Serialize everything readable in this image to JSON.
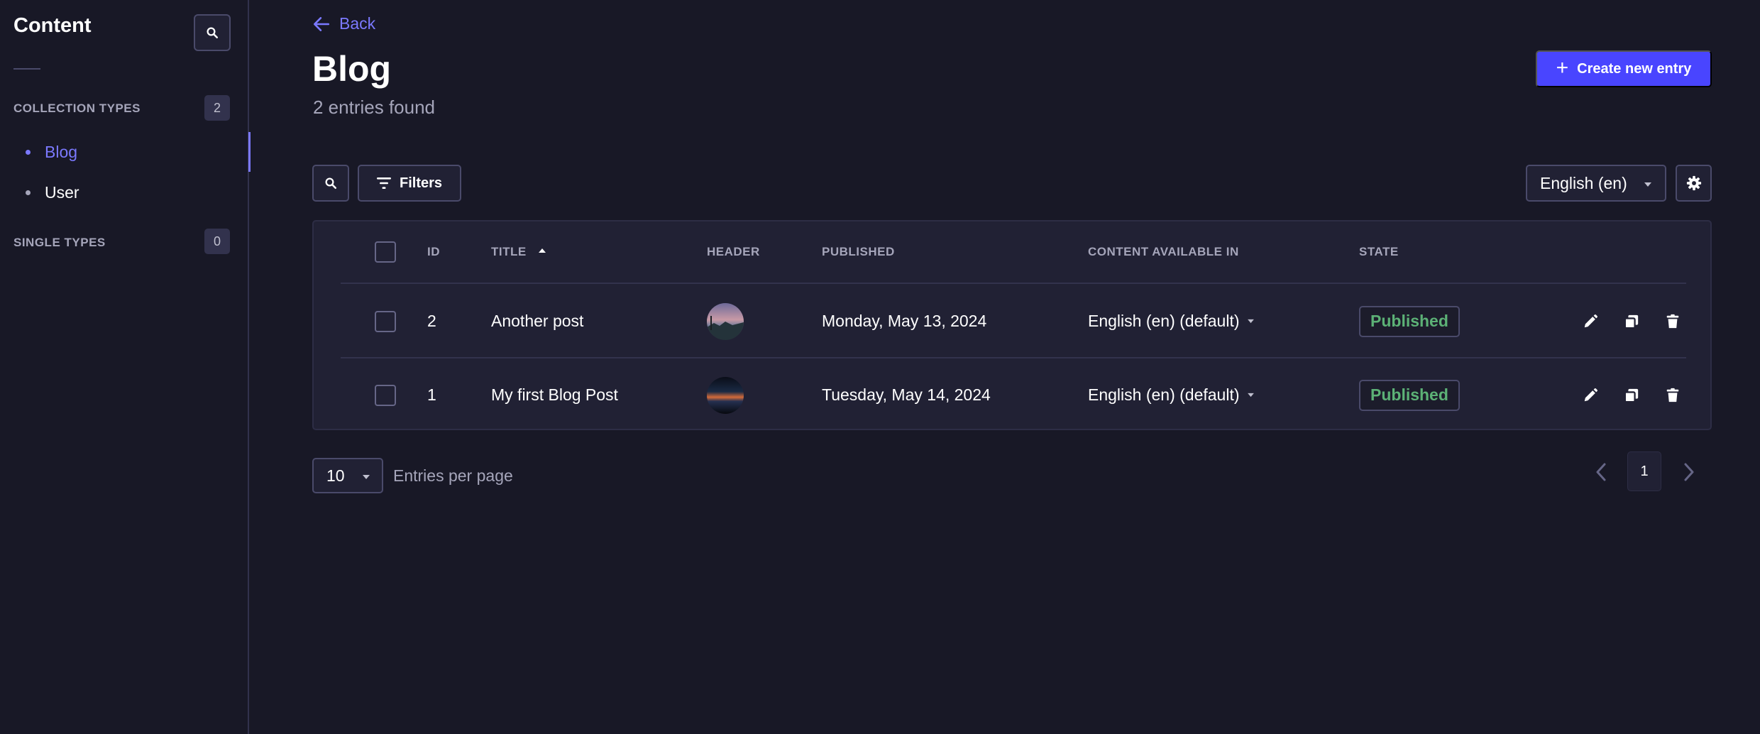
{
  "sidebar": {
    "title": "Content",
    "collection_types": {
      "label": "COLLECTION TYPES",
      "count": "2"
    },
    "items": [
      {
        "label": "Blog",
        "active": true
      },
      {
        "label": "User",
        "active": false
      }
    ],
    "single_types": {
      "label": "SINGLE TYPES",
      "count": "0"
    }
  },
  "header": {
    "back_label": "Back",
    "title": "Blog",
    "subtitle": "2 entries found",
    "create_label": "Create new entry"
  },
  "toolbar": {
    "filters_label": "Filters",
    "locale": "English (en)"
  },
  "table": {
    "columns": {
      "id": "ID",
      "title": "TITLE",
      "header": "HEADER",
      "published": "PUBLISHED",
      "locales": "CONTENT AVAILABLE IN",
      "state": "STATE"
    },
    "rows": [
      {
        "id": "2",
        "title": "Another post",
        "published": "Monday, May 13, 2024",
        "locales": "English (en) (default)",
        "state": "Published"
      },
      {
        "id": "1",
        "title": "My first Blog Post",
        "published": "Tuesday, May 14, 2024",
        "locales": "English (en) (default)",
        "state": "Published"
      }
    ]
  },
  "pagination": {
    "per_page_value": "10",
    "per_page_label": "Entries per page",
    "current_page": "1"
  },
  "colors": {
    "accent": "#4945ff",
    "link": "#7b79ff",
    "published": "#5cb176",
    "background": "#181826",
    "surface": "#212134"
  },
  "icons": [
    "search-icon",
    "arrow-left-icon",
    "plus-icon",
    "filter-icon",
    "gear-icon",
    "caret-down-icon",
    "sort-up-icon",
    "pencil-icon",
    "duplicate-icon",
    "trash-icon",
    "chevron-left-icon",
    "chevron-right-icon"
  ]
}
